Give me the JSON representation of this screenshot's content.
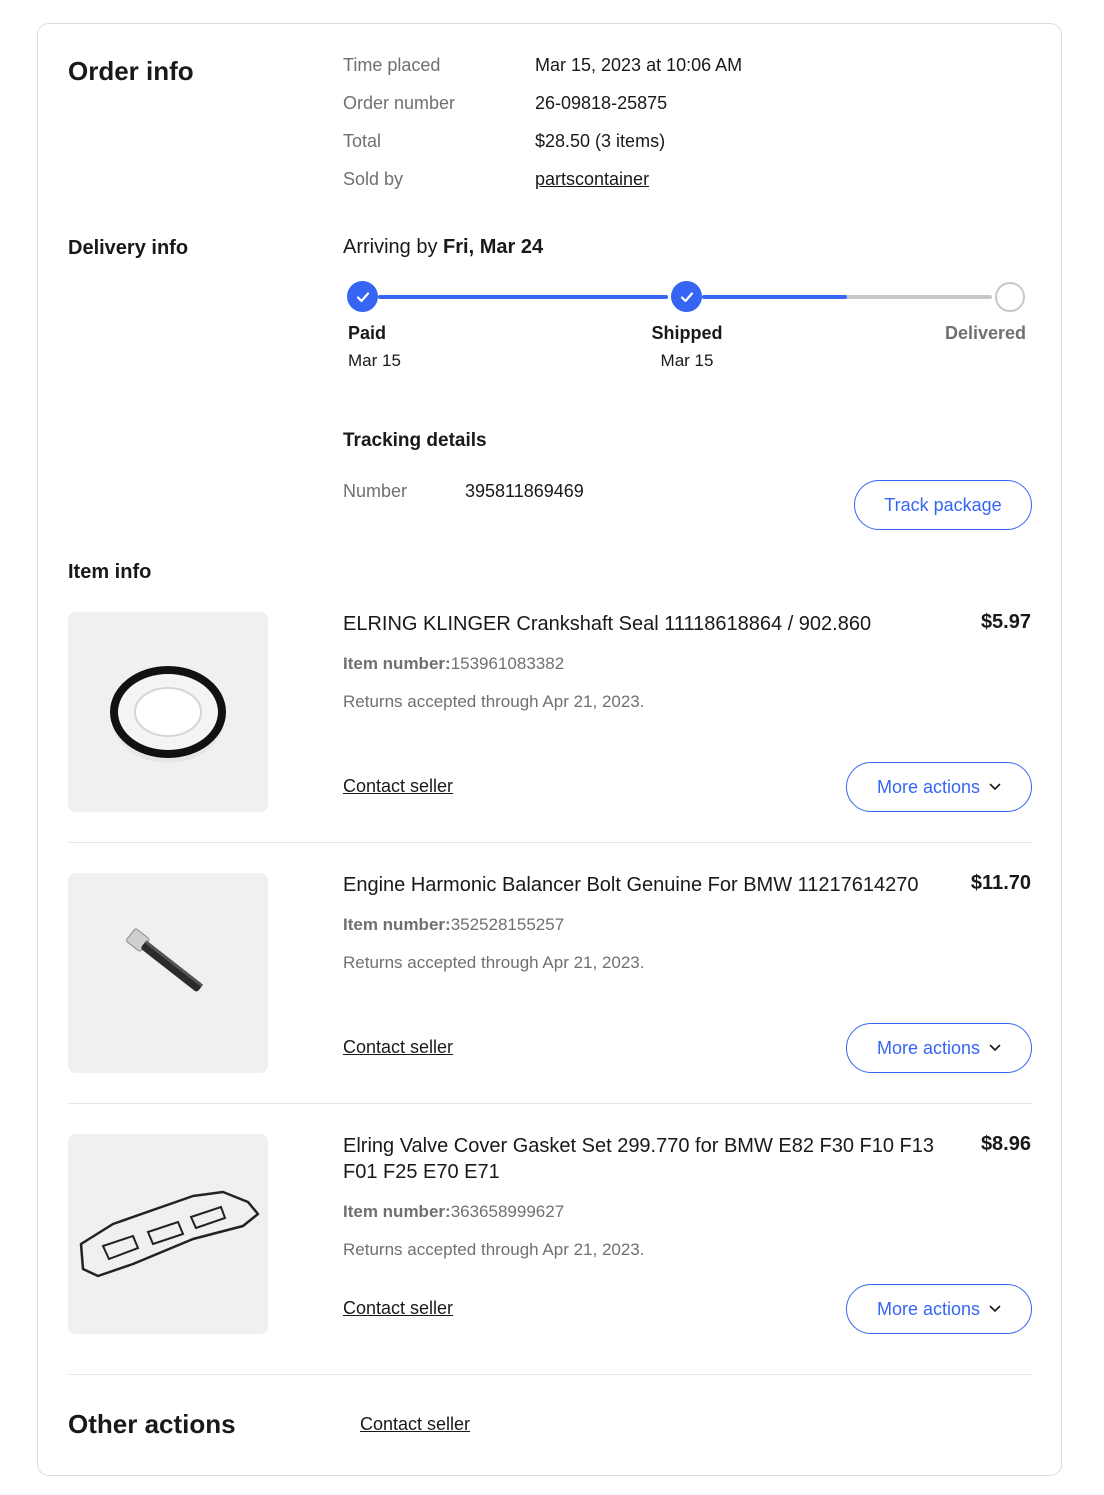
{
  "order_info": {
    "heading": "Order info",
    "rows": [
      {
        "label": "Time placed",
        "value": "Mar 15, 2023 at 10:06 AM"
      },
      {
        "label": "Order number",
        "value": "26-09818-25875"
      },
      {
        "label": "Total",
        "value": "$28.50 (3 items)"
      },
      {
        "label": "Sold by",
        "value": "partscontainer"
      }
    ]
  },
  "delivery_info": {
    "heading": "Delivery info",
    "arriving_prefix": "Arriving by ",
    "arriving_date": "Fri, Mar 24",
    "progress_shipped_to_delivered_fraction": 0.5,
    "steps": [
      {
        "name": "Paid",
        "date": "Mar 15",
        "done": true
      },
      {
        "name": "Shipped",
        "date": "Mar 15",
        "done": true
      },
      {
        "name": "Delivered",
        "date": "",
        "done": false
      }
    ],
    "tracking": {
      "heading": "Tracking details",
      "number_label": "Number",
      "number_value": "395811869469",
      "track_button": "Track package"
    }
  },
  "item_info": {
    "heading": "Item info",
    "item_number_label": "Item number:",
    "contact_label": "Contact seller",
    "more_actions_label": "More actions",
    "items": [
      {
        "title": "ELRING KLINGER Crankshaft Seal 11118618864 / 902.860",
        "price": "$5.97",
        "item_number": "153961083382",
        "returns": "Returns accepted through Apr 21, 2023.",
        "image_icon": "crankshaft-seal-image"
      },
      {
        "title": "Engine Harmonic Balancer Bolt Genuine For BMW 11217614270",
        "price": "$11.70",
        "item_number": "352528155257",
        "returns": "Returns accepted through Apr 21, 2023.",
        "image_icon": "bolt-image"
      },
      {
        "title": "Elring Valve Cover Gasket Set 299.770 for BMW E82 F30 F10 F13 F01 F25 E70 E71",
        "price": "$8.96",
        "item_number": "363658999627",
        "returns": "Returns accepted through Apr 21, 2023.",
        "image_icon": "gasket-image"
      }
    ]
  },
  "other_actions": {
    "heading": "Other actions",
    "contact_label": "Contact seller"
  },
  "colors": {
    "accent": "#3665f3",
    "muted_text": "#707070",
    "primary_text": "#191919",
    "thumb_bg": "#f0f0f0"
  }
}
